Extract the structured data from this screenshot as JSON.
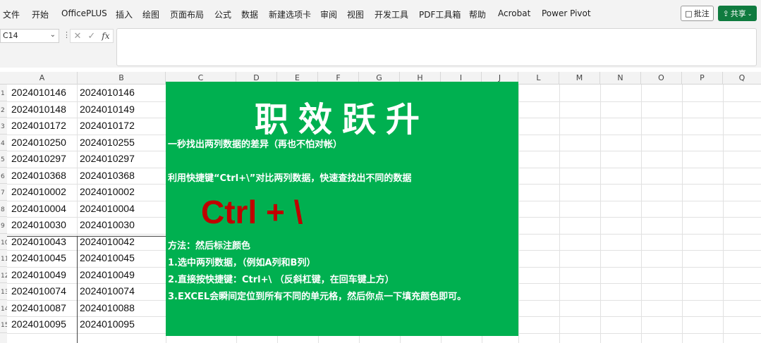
{
  "menu": {
    "items": [
      "文件",
      "开始",
      "OfficePLUS",
      "插入",
      "绘图",
      "页面布局",
      "公式",
      "数据",
      "新建选项卡",
      "审阅",
      "视图",
      "开发工具",
      "PDF工具箱",
      "帮助",
      "Acrobat",
      "Power Pivot"
    ],
    "comment_label": "批注",
    "share_label": "共享"
  },
  "formula_bar": {
    "name_box": "C14",
    "formula_value": ""
  },
  "grid": {
    "columns": [
      "A",
      "B",
      "C",
      "D",
      "E",
      "F",
      "G",
      "H",
      "I",
      "J",
      "L",
      "M",
      "N",
      "O",
      "P",
      "Q"
    ],
    "row_numbers": [
      "1",
      "2",
      "3",
      "4",
      "5",
      "6",
      "7",
      "8",
      "9",
      "10",
      "11",
      "12",
      "13",
      "14",
      "15"
    ],
    "column_a": [
      "2024010146",
      "2024010148",
      "2024010172",
      "2024010250",
      "2024010297",
      "2024010368",
      "2024010002",
      "2024010004",
      "2024010030",
      "2024010043",
      "2024010045",
      "2024010049",
      "2024010074",
      "2024010087",
      "2024010095"
    ],
    "column_b": [
      "2024010146",
      "2024010149",
      "2024010172",
      "2024010255",
      "2024010297",
      "2024010368",
      "2024010002",
      "2024010004",
      "2024010030",
      "2024010042",
      "2024010045",
      "2024010049",
      "2024010074",
      "2024010088",
      "2024010095"
    ]
  },
  "panel": {
    "title": "职效跃升",
    "subtitle": "一秒找出两列数据的差异（再也不怕对帐）",
    "description": "利用快捷键“Ctrl+\\”对比两列数据，快速查找出不同的数据",
    "shortcut": "Ctrl + \\",
    "method_heading": "方法：然后标注颜色",
    "step1": "1.选中两列数据，（例如A列和B列）",
    "step2": "2.直接按快捷键：Ctrl+\\ （反斜杠键，在回车键上方）",
    "step3": "3.EXCEL会瞬间定位到所有不同的单元格，然后你点一下填充颜色即可。",
    "background_color": "#00b050",
    "shortcut_color": "#c00000"
  }
}
